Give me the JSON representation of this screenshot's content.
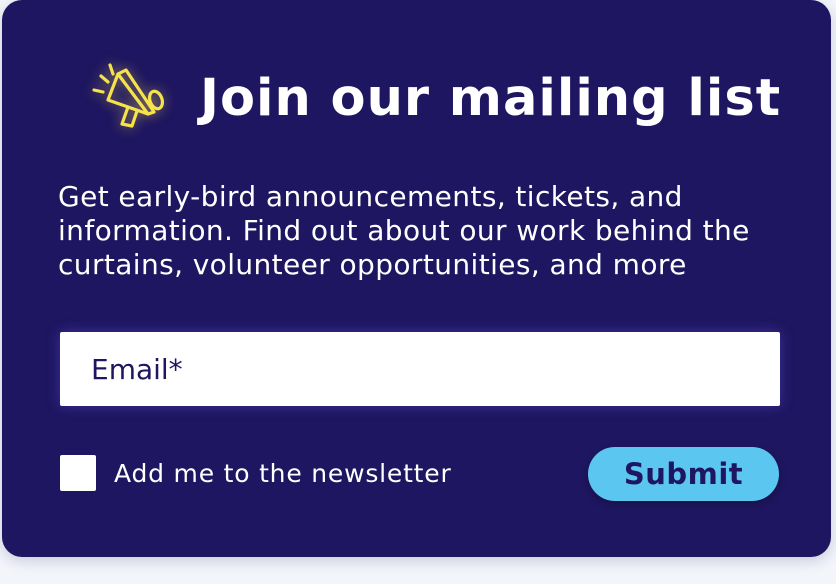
{
  "signup": {
    "icon": "megaphone-icon",
    "title": "Join our mailing list",
    "description": "Get early-bird announcements, tickets, and information. Find out about our work behind the curtains, volunteer opportunities, and more",
    "email": {
      "placeholder": "Email*",
      "value": ""
    },
    "newsletter": {
      "label": "Add me to the newsletter",
      "checked": false
    },
    "submit_label": "Submit"
  },
  "colors": {
    "card_background": "#1e1660",
    "accent_yellow": "#f6e34b",
    "button_background": "#5bc7f0",
    "text_white": "#ffffff"
  }
}
